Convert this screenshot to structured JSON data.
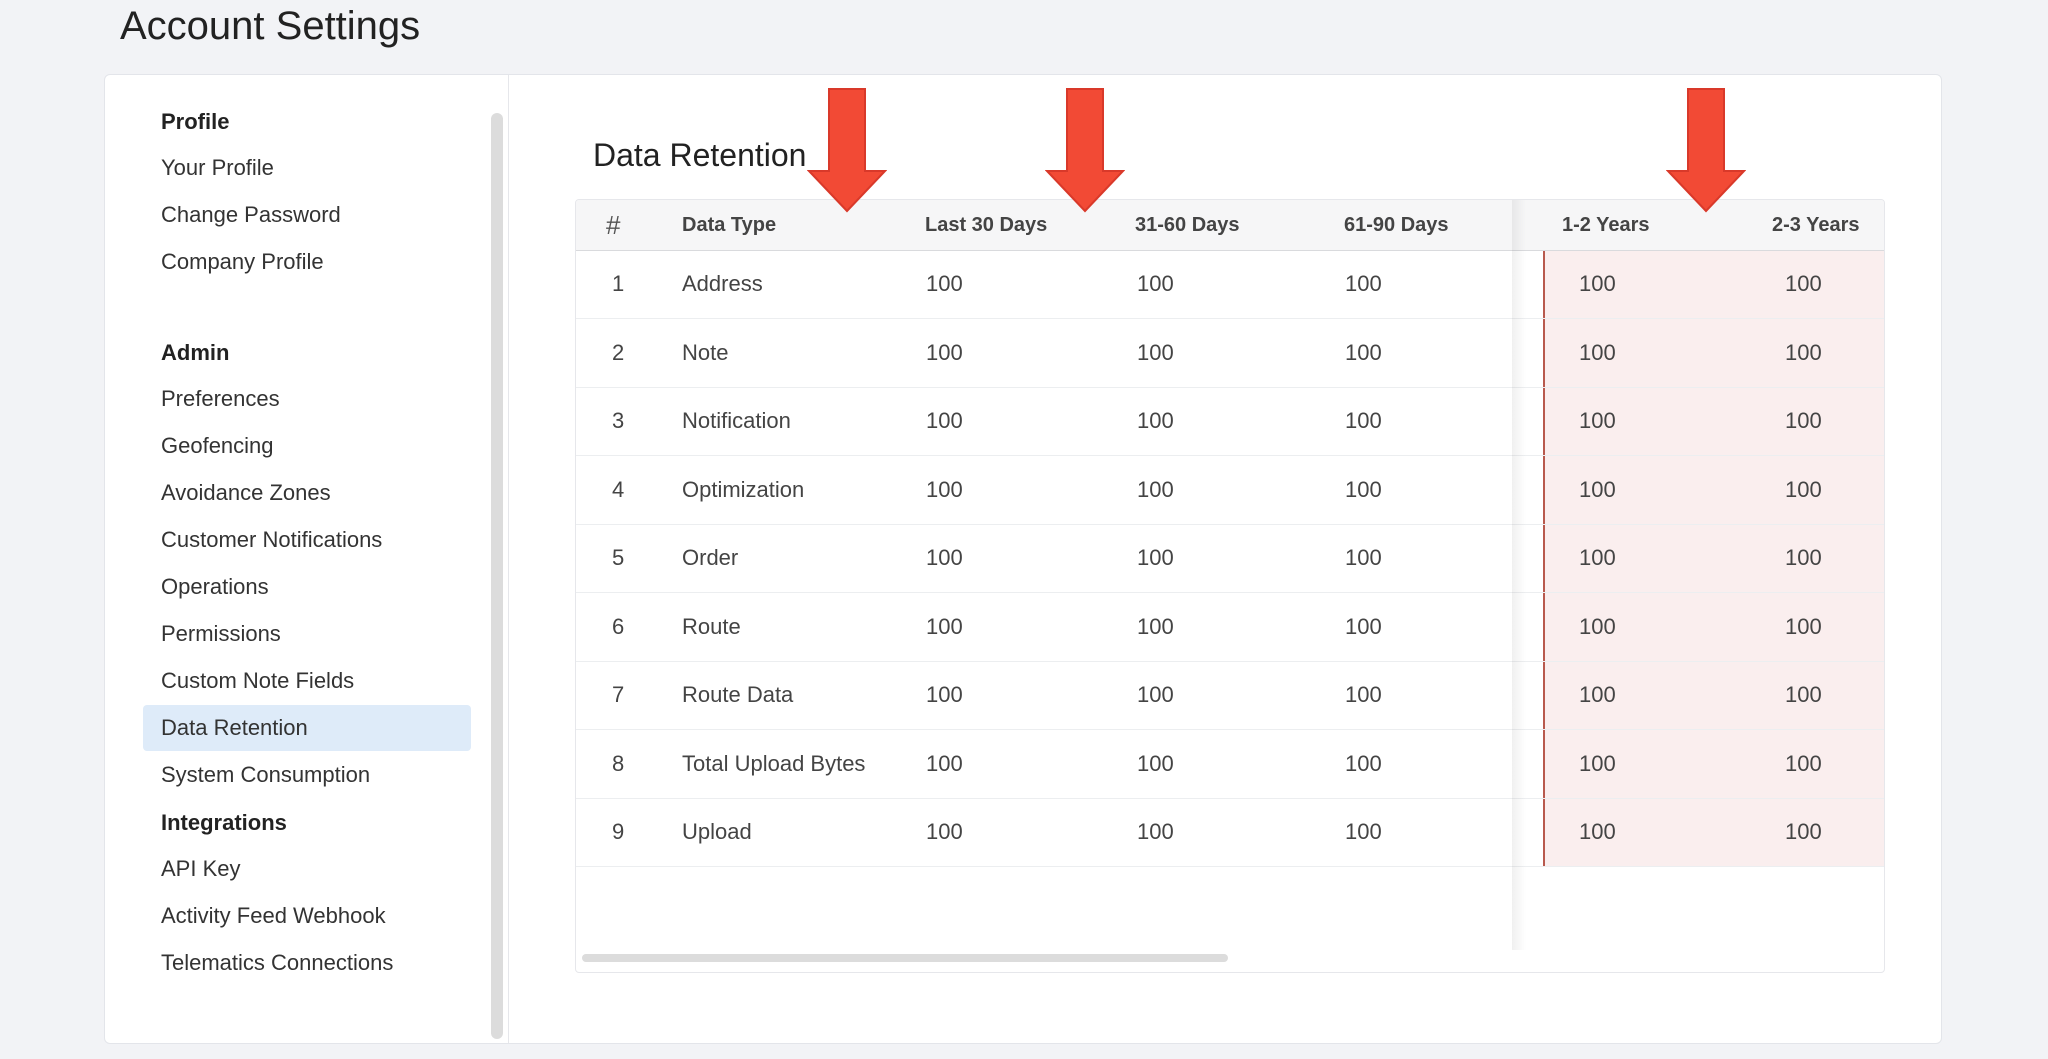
{
  "page_title": "Account Settings",
  "sidebar": {
    "sections": [
      {
        "heading": "Profile",
        "items": [
          "Your Profile",
          "Change Password",
          "Company Profile"
        ]
      },
      {
        "heading": "Admin",
        "items": [
          "Preferences",
          "Geofencing",
          "Avoidance Zones",
          "Customer Notifications",
          "Operations",
          "Permissions",
          "Custom Note Fields",
          "Data Retention",
          "System Consumption"
        ]
      },
      {
        "heading": "Integrations",
        "items": [
          "API Key",
          "Activity Feed Webhook",
          "Telematics Connections"
        ]
      }
    ],
    "active_item": "Data Retention"
  },
  "main": {
    "section_title": "Data Retention",
    "table": {
      "columns": [
        "#",
        "Data Type",
        "Last 30 Days",
        "31-60 Days",
        "61-90 Days",
        "1-2 Years",
        "2-3 Years"
      ],
      "rows": [
        [
          "1",
          "Address",
          "100",
          "100",
          "100",
          "100",
          "100"
        ],
        [
          "2",
          "Note",
          "100",
          "100",
          "100",
          "100",
          "100"
        ],
        [
          "3",
          "Notification",
          "100",
          "100",
          "100",
          "100",
          "100"
        ],
        [
          "4",
          "Optimization",
          "100",
          "100",
          "100",
          "100",
          "100"
        ],
        [
          "5",
          "Order",
          "100",
          "100",
          "100",
          "100",
          "100"
        ],
        [
          "6",
          "Route",
          "100",
          "100",
          "100",
          "100",
          "100"
        ],
        [
          "7",
          "Route Data",
          "100",
          "100",
          "100",
          "100",
          "100"
        ],
        [
          "8",
          "Total Upload Bytes",
          "100",
          "100",
          "100",
          "100",
          "100"
        ],
        [
          "9",
          "Upload",
          "100",
          "100",
          "100",
          "100",
          "100"
        ]
      ]
    }
  },
  "annotations": {
    "arrow_color": "#f24a35",
    "arrow_targets": [
      "Data Type",
      "Last 30 Days",
      "1-2 Years"
    ]
  },
  "colors": {
    "active_item_bg": "#deebf9",
    "highlight_bg": "#faeeee",
    "highlight_border": "#b8594d"
  }
}
